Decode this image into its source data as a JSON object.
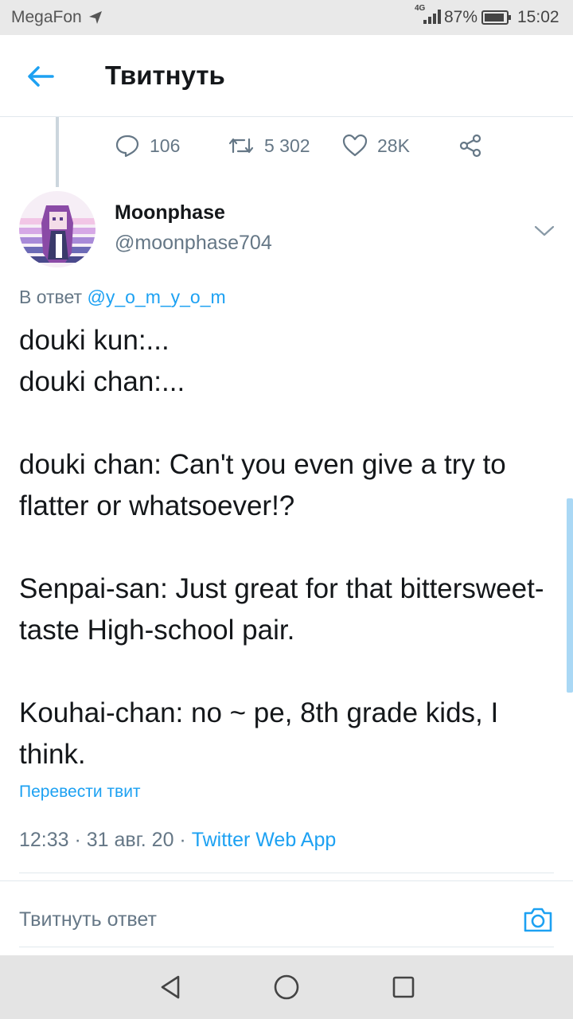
{
  "status_bar": {
    "carrier": "MegaFon",
    "network": "4G",
    "battery_percent": "87%",
    "time": "15:02"
  },
  "header": {
    "title": "Твитнуть"
  },
  "previous_tweet_actions": {
    "replies": "106",
    "retweets": "5 302",
    "likes": "28K"
  },
  "tweet": {
    "author_name": "Moonphase",
    "author_handle": "@moonphase704",
    "reply_prefix": "В ответ",
    "reply_to": "@y_o_m_y_o_m",
    "text": "douki kun:...\ndouki chan:...\n\ndouki chan: Can't you even give a try to flatter or whatsoever!?\n\nSenpai-san: Just great for that bittersweet-taste High-school pair.\n\nKouhai-chan: no ~ pe, 8th grade kids, I think.",
    "translate_label": "Перевести твит",
    "timestamp": "12:33 · 31 авг. 20",
    "separator": " · ",
    "source_app": "Twitter Web App"
  },
  "reply_box": {
    "placeholder": "Твитнуть ответ"
  },
  "colors": {
    "accent": "#1da1f2",
    "secondary_text": "#657786",
    "primary_text": "#14171a",
    "divider": "#e1e8ed"
  },
  "icons": {
    "back": "arrow-left-icon",
    "reply": "speech-bubble-icon",
    "retweet": "retweet-icon",
    "like": "heart-icon",
    "share": "share-icon",
    "caret": "chevron-down-icon",
    "camera": "camera-icon"
  }
}
